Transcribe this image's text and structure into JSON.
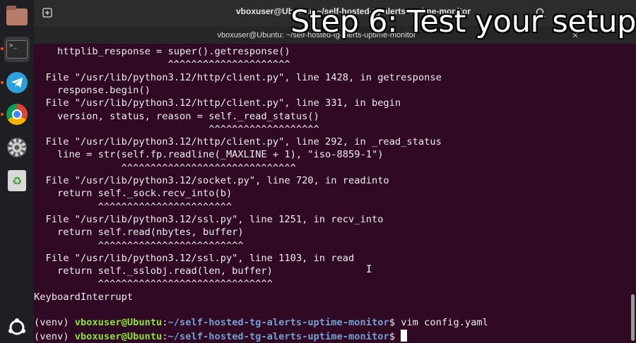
{
  "window": {
    "title": "vboxuser@Ubuntu: ~/self-hosted-tg-alerts-uptime-monitor",
    "tab_label": "vboxuser@Ubuntu: ~/self-hosted-tg-alerts-uptime-monitor"
  },
  "overlay": {
    "caption": "Step 6: Test your setup"
  },
  "dock": {
    "items": [
      {
        "name": "files",
        "icon": "folder-icon"
      },
      {
        "name": "terminal",
        "icon": "terminal-icon",
        "label": ">_"
      },
      {
        "name": "telegram",
        "icon": "telegram-icon"
      },
      {
        "name": "chrome",
        "icon": "chrome-icon"
      },
      {
        "name": "settings",
        "icon": "gear-icon"
      },
      {
        "name": "trash",
        "icon": "trash-icon",
        "label": "♻"
      },
      {
        "name": "apps",
        "icon": "show-apps-icon"
      }
    ]
  },
  "terminal": {
    "lines": [
      "    httplib_response = super().getresponse()",
      "                       ^^^^^^^^^^^^^^^^^^^^^",
      "  File \"/usr/lib/python3.12/http/client.py\", line 1428, in getresponse",
      "    response.begin()",
      "  File \"/usr/lib/python3.12/http/client.py\", line 331, in begin",
      "    version, status, reason = self._read_status()",
      "                              ^^^^^^^^^^^^^^^^^^^",
      "  File \"/usr/lib/python3.12/http/client.py\", line 292, in _read_status",
      "    line = str(self.fp.readline(_MAXLINE + 1), \"iso-8859-1\")",
      "               ^^^^^^^^^^^^^^^^^^^^^^^^^^^^^^",
      "  File \"/usr/lib/python3.12/socket.py\", line 720, in readinto",
      "    return self._sock.recv_into(b)",
      "           ^^^^^^^^^^^^^^^^^^^^^^^",
      "  File \"/usr/lib/python3.12/ssl.py\", line 1251, in recv_into",
      "    return self.read(nbytes, buffer)",
      "           ^^^^^^^^^^^^^^^^^^^^^^^^^",
      "  File \"/usr/lib/python3.12/ssl.py\", line 1103, in read",
      "    return self._sslobj.read(len, buffer)",
      "           ^^^^^^^^^^^^^^^^^^^^^^^^^^^^^^",
      "KeyboardInterrupt",
      ""
    ],
    "prompts": [
      {
        "venv": "(venv) ",
        "user": "vboxuser@Ubuntu",
        "sep": ":",
        "path": "~/self-hosted-tg-alerts-uptime-monitor",
        "dollar": "$ ",
        "command": "vim config.yaml"
      },
      {
        "venv": "(venv) ",
        "user": "vboxuser@Ubuntu",
        "sep": ":",
        "path": "~/self-hosted-tg-alerts-uptime-monitor",
        "dollar": "$ ",
        "command": ""
      }
    ]
  },
  "colors": {
    "terminal_bg": "#300a24",
    "prompt_user": "#8ae234",
    "prompt_path": "#729fcf",
    "accent": "#e95420"
  }
}
